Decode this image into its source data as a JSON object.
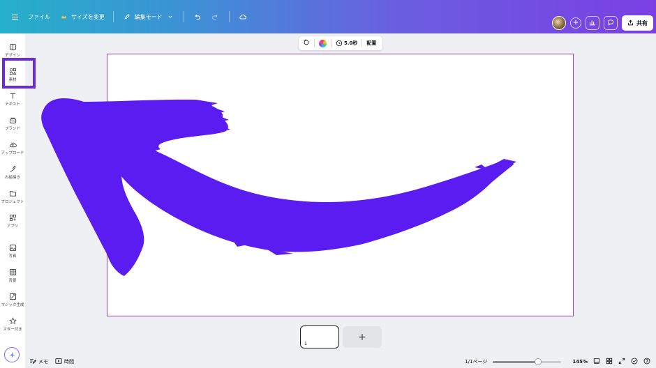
{
  "topbar": {
    "menu_icon": "hamburger-icon",
    "file_label": "ファイル",
    "resize_label": "サイズを変更",
    "edit_mode_label": "編集モード",
    "share_label": "共有"
  },
  "sidebar": {
    "items": [
      {
        "label": "デザイン",
        "icon": "design-icon"
      },
      {
        "label": "素材",
        "icon": "elements-icon"
      },
      {
        "label": "テキスト",
        "icon": "text-icon"
      },
      {
        "label": "ブランド",
        "icon": "brand-icon"
      },
      {
        "label": "アップロード",
        "icon": "upload-icon"
      },
      {
        "label": "お絵描き",
        "icon": "draw-icon"
      },
      {
        "label": "プロジェクト",
        "icon": "folder-icon"
      },
      {
        "label": "アプリ",
        "icon": "apps-icon"
      },
      {
        "label": "写真",
        "icon": "photo-icon"
      },
      {
        "label": "背景",
        "icon": "background-icon"
      },
      {
        "label": "マジック生成",
        "icon": "magic-icon"
      },
      {
        "label": "スター付き",
        "icon": "star-icon"
      }
    ],
    "active_index": 1
  },
  "context_toolbar": {
    "duration": "5.0秒",
    "position_label": "配置"
  },
  "canvas": {
    "arrow_color": "#5a1cf0",
    "page_number": "1",
    "add_page_symbol": "+"
  },
  "bottombar": {
    "notes_label": "メモ",
    "timer_label": "時間",
    "page_indicator": "1/1ページ",
    "zoom_fraction": 0.66,
    "zoom_label": "145%"
  },
  "colors": {
    "accent": "#8b3dff",
    "highlight_box": "#6a2cd9"
  }
}
